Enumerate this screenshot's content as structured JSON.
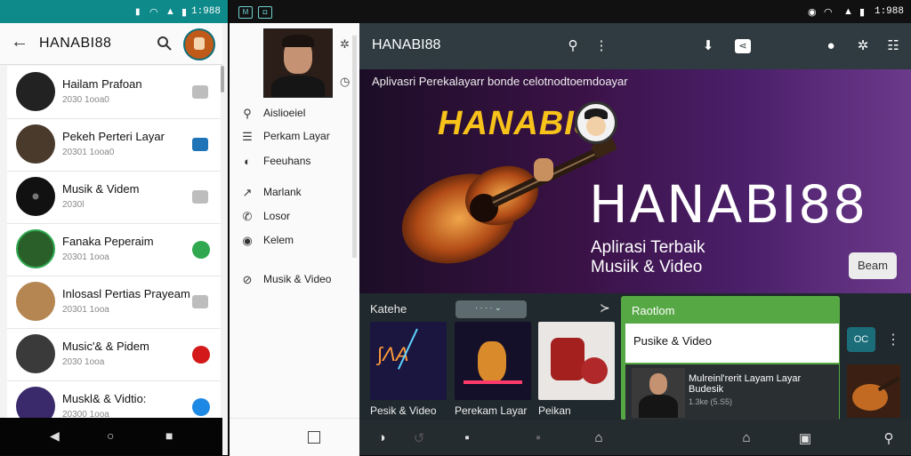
{
  "phone1": {
    "status_time": "1:988",
    "title": "HANABI88",
    "rows": [
      {
        "name": "Hailam Prafoan",
        "sub": "2030 1ooa0",
        "color": "#222222",
        "action_color": "#bdbdbd"
      },
      {
        "name": "Pekeh Perteri Layar",
        "sub": "20301 1ooa0",
        "color": "#4a3a2c",
        "action_color": "#1f73b7"
      },
      {
        "name": "Musik & Videm",
        "sub": "2030l",
        "color": "#1c1c1c",
        "action_color": "#bdbdbd"
      },
      {
        "name": "Fanaka Peperaim",
        "sub": "20301 1ooa",
        "color": "#2a5f2a",
        "action_color": "#2fa84f"
      },
      {
        "name": "Inlosasl Pertias Prayeam",
        "sub": "20301 1ooa",
        "color": "#b58652",
        "action_color": "#bdbdbd"
      },
      {
        "name": "Music'& & Pidem",
        "sub": "2030 1ooa",
        "color": "#3a3a3a",
        "action_color": "#d31919"
      },
      {
        "name": "Muskl& & Vidtio:",
        "sub": "20300 1ooa",
        "color": "#3b2a6b",
        "action_color": "#1e88e5"
      }
    ]
  },
  "drawer": {
    "items": [
      {
        "icon": "person-icon",
        "glyph": "⚲",
        "label": "Aislioeiel"
      },
      {
        "icon": "list-icon",
        "glyph": "☰",
        "label": "Perkam Layar"
      },
      {
        "icon": "download-icon",
        "glyph": "◐",
        "label": "Feeuhans"
      },
      {
        "icon": "share-icon",
        "glyph": "↗",
        "label": "Marlank"
      },
      {
        "icon": "phone-icon",
        "glyph": "✆",
        "label": "Losor"
      },
      {
        "icon": "info-icon",
        "glyph": "◉",
        "label": "Kelem"
      },
      {
        "icon": "help-icon",
        "glyph": "⊘",
        "label": "Musik & Video"
      }
    ]
  },
  "app": {
    "status_time": "1:988",
    "title": "HANABI88",
    "hero": {
      "subtitle": "Aplivasri Perekalayarr bonde celotnodtoemdoayar",
      "logo_text": "HANABI88",
      "big_title": "HANABI88",
      "line1": "Aplirasi Terbaik",
      "line2": "Musiik & Video",
      "button": "Beam"
    },
    "strip": {
      "label": "Katehe",
      "thumbs": [
        {
          "label": "Pesik & Video",
          "bg": "#1a1640"
        },
        {
          "label": "Perekam Layar",
          "bg": "#14102a"
        },
        {
          "label": "Peikan",
          "bg": "#e9e6e3"
        }
      ]
    },
    "card": {
      "title": "Raotlom",
      "inner_label": "Pusike & Video",
      "text1": "Mulreinl'rerit Layam Layar Budesik",
      "text2": "1.3ke (5.S5)",
      "side_button": "ОС"
    },
    "colors": {
      "status_teal": "#0e8a8a",
      "card_green": "#56a845",
      "hero_gold": "#f7c21a"
    }
  }
}
